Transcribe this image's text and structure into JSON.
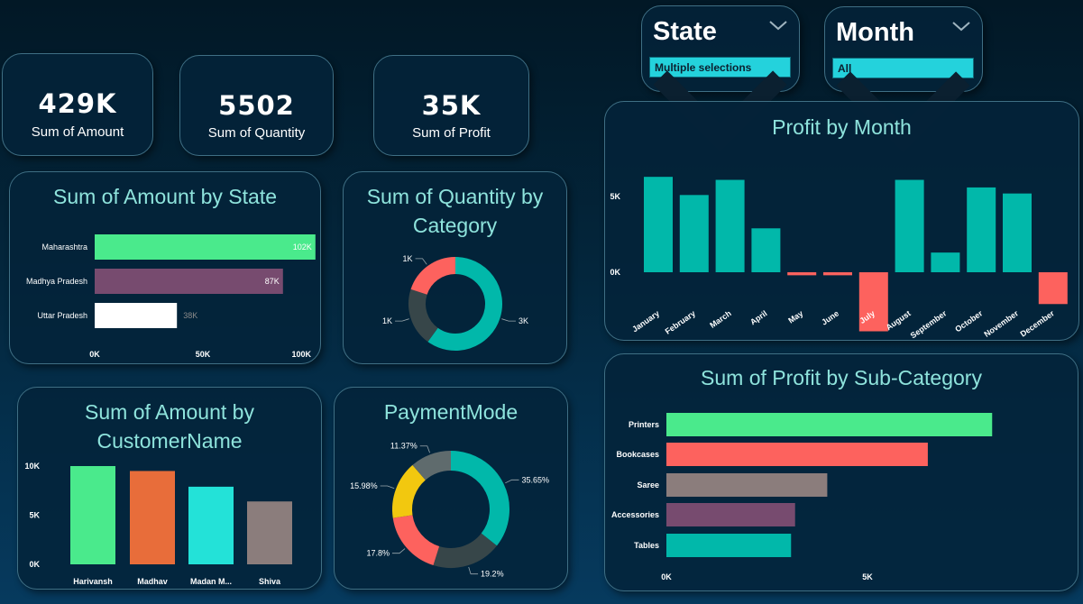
{
  "kpis": [
    {
      "value": "429K",
      "label": "Sum of Amount"
    },
    {
      "value": "5502",
      "label": "Sum of Quantity"
    },
    {
      "value": "35K",
      "label": "Sum of Profit"
    }
  ],
  "slicers": {
    "state": {
      "title": "State",
      "value": "Multiple selections"
    },
    "month": {
      "title": "Month",
      "value": "All"
    }
  },
  "colors": {
    "teal": "#01b8aa",
    "green": "#4aea8c",
    "red": "#fd625e",
    "purple": "#774b6f",
    "orange": "#e86d3a",
    "cyan": "#23e2d8",
    "grey": "#8b7d7c",
    "dark": "#374649",
    "yellow": "#f2c80f",
    "white": "#ffffff"
  },
  "chart_data": [
    {
      "id": "amount_by_state",
      "type": "bar",
      "orientation": "horizontal",
      "title": "Sum of Amount by State",
      "categories": [
        "Maharashtra",
        "Madhya Pradesh",
        "Uttar Pradesh"
      ],
      "values": [
        102000,
        87000,
        38000
      ],
      "data_labels": [
        "102K",
        "87K",
        "38K"
      ],
      "bar_colors": [
        "#4aea8c",
        "#774b6f",
        "#ffffff"
      ],
      "xlim": [
        0,
        100000
      ],
      "xticks": [
        "0K",
        "50K",
        "100K"
      ]
    },
    {
      "id": "quantity_by_category",
      "type": "pie",
      "donut": true,
      "title": "Sum of Quantity by Category",
      "values": [
        3000,
        1000,
        1000
      ],
      "data_labels": [
        "3K",
        "1K",
        "1K"
      ],
      "colors": [
        "#01b8aa",
        "#374649",
        "#fd625e"
      ]
    },
    {
      "id": "profit_by_month",
      "type": "bar",
      "title": "Profit by Month",
      "categories": [
        "January",
        "February",
        "March",
        "April",
        "May",
        "June",
        "July",
        "August",
        "September",
        "October",
        "November",
        "December"
      ],
      "values": [
        6300,
        5100,
        6100,
        2900,
        -200,
        -200,
        -3900,
        6100,
        1300,
        5600,
        5200,
        -2100
      ],
      "bar_colors": [
        "#01b8aa",
        "#01b8aa",
        "#01b8aa",
        "#01b8aa",
        "#fd625e",
        "#fd625e",
        "#fd625e",
        "#01b8aa",
        "#01b8aa",
        "#01b8aa",
        "#01b8aa",
        "#fd625e"
      ],
      "yticks": [
        "5K",
        "0K"
      ],
      "ylim": [
        -4000,
        7000
      ]
    },
    {
      "id": "amount_by_customer",
      "type": "bar",
      "title": "Sum of Amount by CustomerName",
      "categories": [
        "Harivansh",
        "Madhav",
        "Madan M...",
        "Shiva"
      ],
      "values": [
        10000,
        9500,
        7900,
        6400
      ],
      "bar_colors": [
        "#4aea8c",
        "#e86d3a",
        "#23e2d8",
        "#8b7d7c"
      ],
      "ylim": [
        0,
        10000
      ],
      "yticks": [
        "10K",
        "5K",
        "0K"
      ]
    },
    {
      "id": "payment_mode",
      "type": "pie",
      "donut": true,
      "title": "PaymentMode",
      "values": [
        35.65,
        19.2,
        17.8,
        15.98,
        11.37
      ],
      "data_labels": [
        "35.65%",
        "19.2%",
        "17.8%",
        "15.98%",
        "11.37%"
      ],
      "colors": [
        "#01b8aa",
        "#374649",
        "#fd625e",
        "#f2c80f",
        "#5f6b6d"
      ]
    },
    {
      "id": "profit_by_subcategory",
      "type": "bar",
      "orientation": "horizontal",
      "title": "Sum of Profit by Sub-Category",
      "categories": [
        "Printers",
        "Bookcases",
        "Saree",
        "Accessories",
        "Tables"
      ],
      "values": [
        8100,
        6500,
        4000,
        3200,
        3100
      ],
      "bar_colors": [
        "#4aea8c",
        "#fd625e",
        "#8b7d7c",
        "#774b6f",
        "#01b8aa"
      ],
      "xlim": [
        0,
        10000
      ],
      "xticks": [
        "0K",
        "5K"
      ]
    }
  ]
}
